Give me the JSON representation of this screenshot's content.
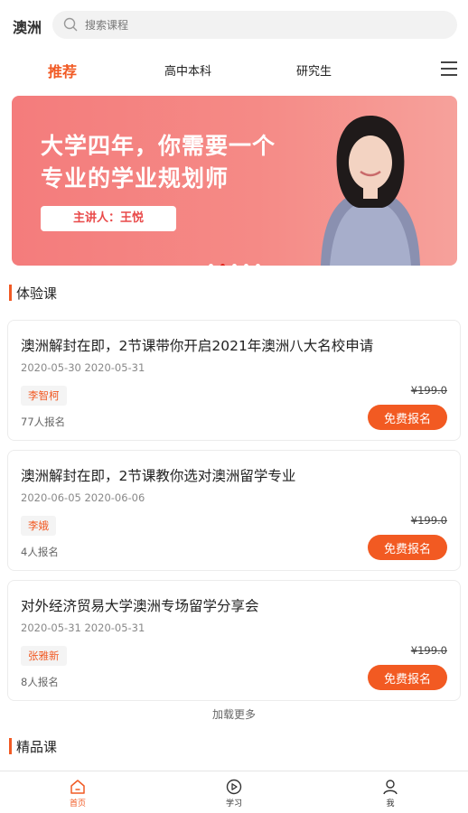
{
  "header": {
    "city": "澳洲",
    "search_placeholder": "搜索课程"
  },
  "tabs": [
    {
      "label": "推荐",
      "active": true
    },
    {
      "label": "高中本科",
      "active": false
    },
    {
      "label": "研究生",
      "active": false
    }
  ],
  "banner": {
    "title_line1": "大学四年，你需要一个",
    "title_line2": "专业的学业规划师",
    "lecturer": "主讲人：王悦",
    "slide_count": 5,
    "active_slide": 2
  },
  "sections": {
    "trial": "体验课",
    "premium": "精品课"
  },
  "courses": [
    {
      "title": "澳洲解封在即，2节课带你开启2021年澳洲八大名校申请",
      "dates": "2020-05-30 2020-05-31",
      "teacher": "李智柯",
      "enrolled": "77人报名",
      "price": "¥199.0",
      "button": "免费报名"
    },
    {
      "title": "澳洲解封在即，2节课教你选对澳洲留学专业",
      "dates": "2020-06-05 2020-06-06",
      "teacher": "李娥",
      "enrolled": "4人报名",
      "price": "¥199.0",
      "button": "免费报名"
    },
    {
      "title": "对外经济贸易大学澳洲专场留学分享会",
      "dates": "2020-05-31 2020-05-31",
      "teacher": "张雅新",
      "enrolled": "8人报名",
      "price": "¥199.0",
      "button": "免费报名"
    }
  ],
  "load_more": "加载更多",
  "bottom_nav": [
    {
      "label": "首页",
      "icon": "home-icon",
      "active": true
    },
    {
      "label": "学习",
      "icon": "play-icon",
      "active": false
    },
    {
      "label": "我",
      "icon": "user-icon",
      "active": false
    }
  ],
  "colors": {
    "accent": "#f15a24",
    "banner": "#f47c7c"
  }
}
